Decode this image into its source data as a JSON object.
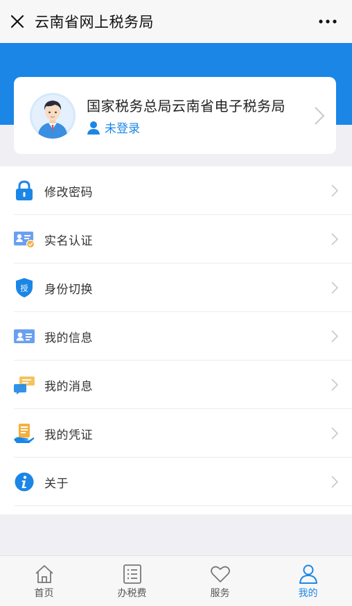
{
  "navbar": {
    "title": "云南省网上税务局",
    "close_icon": "close-icon",
    "more_icon": "more-icon"
  },
  "profile": {
    "name": "国家税务总局云南省电子税务局",
    "login_status": "未登录",
    "avatar_icon": "user-avatar"
  },
  "menu": {
    "items": [
      {
        "label": "修改密码",
        "icon": "lock-icon"
      },
      {
        "label": "实名认证",
        "icon": "id-verify-icon"
      },
      {
        "label": "身份切换",
        "icon": "shield-auth-icon"
      },
      {
        "label": "我的信息",
        "icon": "id-card-icon"
      },
      {
        "label": "我的消息",
        "icon": "chat-bubble-icon"
      },
      {
        "label": "我的凭证",
        "icon": "receipt-hand-icon"
      },
      {
        "label": "关于",
        "icon": "info-icon"
      }
    ]
  },
  "tabbar": {
    "tabs": [
      {
        "label": "首页",
        "icon": "home-icon"
      },
      {
        "label": "办税费",
        "icon": "list-icon"
      },
      {
        "label": "服务",
        "icon": "heart-icon"
      },
      {
        "label": "我的",
        "icon": "person-icon"
      }
    ],
    "active_tab": "我的"
  },
  "colors": {
    "accent": "#1b86e6",
    "banner": "#1b86e6",
    "background": "#efeff4"
  }
}
